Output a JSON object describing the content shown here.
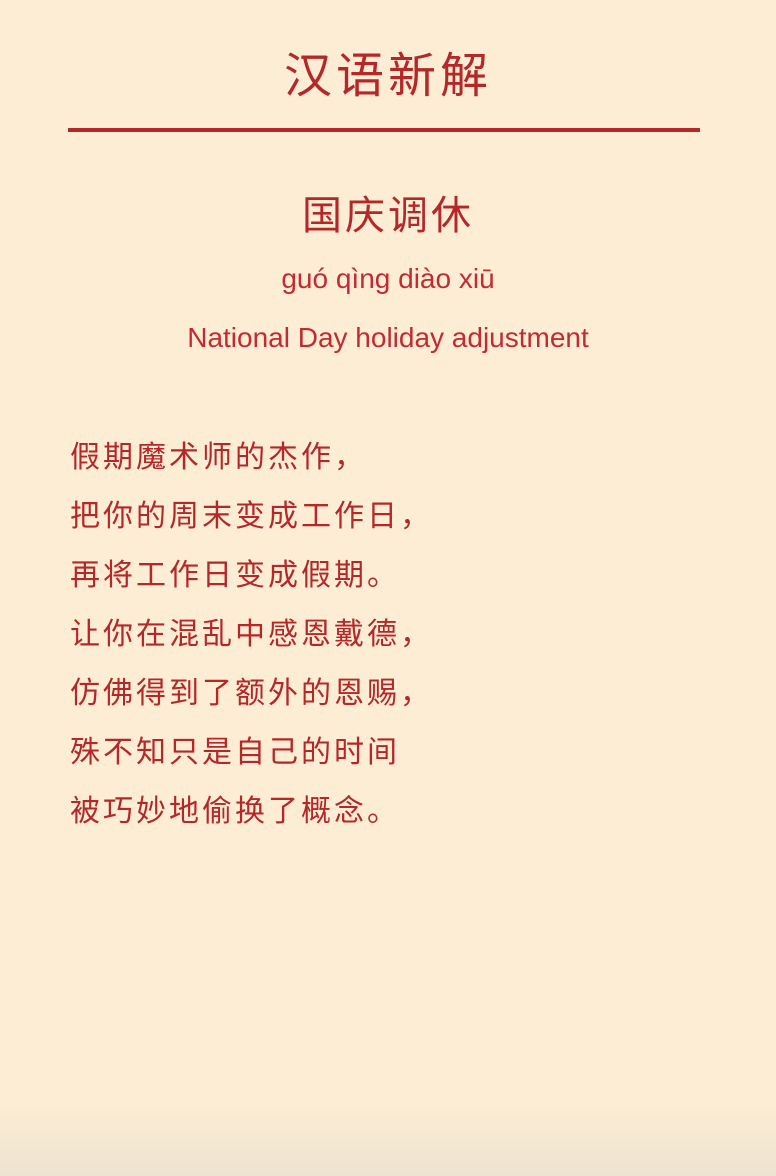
{
  "header": {
    "title": "汉语新解"
  },
  "entry": {
    "term": "国庆调休",
    "pinyin": "guó qìng diào xiū",
    "english": "National Day holiday adjustment"
  },
  "poem": {
    "lines": [
      "假期魔术师的杰作，",
      "把你的周末变成工作日，",
      "再将工作日变成假期。",
      "让你在混乱中感恩戴德，",
      "仿佛得到了额外的恩赐，",
      "殊不知只是自己的时间",
      "被巧妙地偷换了概念。"
    ]
  },
  "colors": {
    "background": "#fcedd4",
    "accent": "#b5282a"
  }
}
